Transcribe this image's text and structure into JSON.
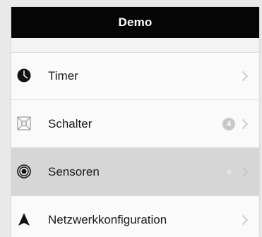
{
  "nav": {
    "title": "Demo"
  },
  "items": [
    {
      "label": "Timer",
      "icon": "clock-icon",
      "badge": ""
    },
    {
      "label": "Schalter",
      "icon": "switch-icon",
      "badge": "4"
    },
    {
      "label": "Sensoren",
      "icon": "sensor-icon",
      "badge": "4",
      "selected": true
    },
    {
      "label": "Netzwerkkonfiguration",
      "icon": "network-icon",
      "badge": ""
    }
  ],
  "colors": {
    "nav_bar": "#050505",
    "selected_row": "#d7d6d7",
    "badge": "#c9c8c9",
    "chevron": "#c7c7cc"
  }
}
